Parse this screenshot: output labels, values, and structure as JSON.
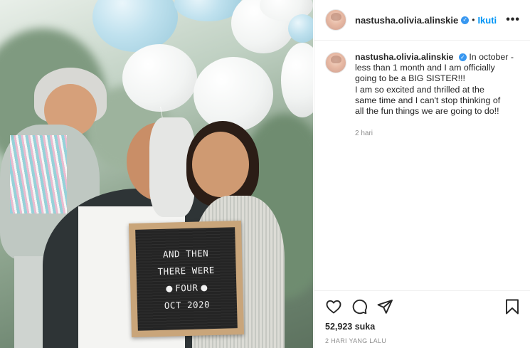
{
  "post": {
    "username": "nastusha.olivia.alinskie",
    "follow_label": "Ikuti",
    "more_label": "•••",
    "verified_glyph": "✓",
    "caption": {
      "username": "nastusha.olivia.alinskie",
      "line1": "In october -",
      "line2": "less than 1 month and I am officially",
      "line3": "going to be a BIG SISTER!!!",
      "line4": "I am so excited and thrilled at the",
      "line5": "same time and I can't stop thinking of",
      "line6": "all the fun things we are going to do!!"
    },
    "time_ago": "2 hari",
    "likes": "52,923 suka",
    "posted": "2 HARI YANG LALU"
  },
  "photo": {
    "board_lines": [
      "AND THEN",
      "THERE WERE",
      "FOUR",
      "OCT 2020"
    ]
  },
  "icons": {
    "like": "heart-icon",
    "comment": "comment-icon",
    "share": "share-icon",
    "save": "bookmark-icon",
    "more": "more-options-icon",
    "verified": "verified-badge-icon"
  },
  "colors": {
    "follow_blue": "#0095f6",
    "verified_blue": "#3897f0",
    "text": "#262626",
    "muted": "#8e8e8e"
  }
}
